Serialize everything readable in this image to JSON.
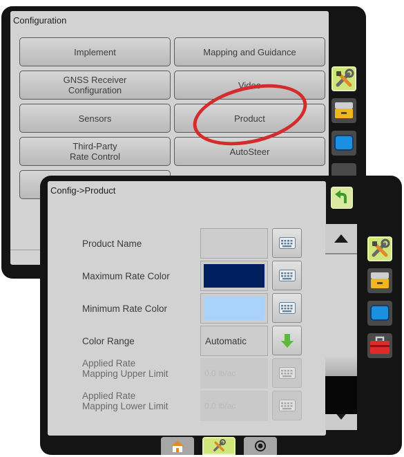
{
  "config_screen": {
    "title": "Configuration",
    "buttons": [
      {
        "label": "Implement"
      },
      {
        "label": "Mapping and Guidance"
      },
      {
        "label": "GNSS Receiver\nConfiguration"
      },
      {
        "label": "Video"
      },
      {
        "label": "Sensors"
      },
      {
        "label": "Product"
      },
      {
        "label": "Third-Party\nRate Control"
      },
      {
        "label": "AutoSteer"
      }
    ]
  },
  "product_screen": {
    "title": "Config->Product",
    "rows": {
      "product_name": {
        "label": "Product Name",
        "value": ""
      },
      "max_rate_color": {
        "label": "Maximum Rate Color",
        "color": "#001f5e"
      },
      "min_rate_color": {
        "label": "Minimum Rate Color",
        "color": "#a9d3fb"
      },
      "color_range": {
        "label": "Color Range",
        "value": "Automatic"
      },
      "upper_limit": {
        "label": "Applied Rate\nMapping Upper Limit",
        "value": "0.0 lb/ac"
      },
      "lower_limit": {
        "label": "Applied Rate\nMapping Lower Limit",
        "value": "0.0 lb/ac"
      }
    }
  },
  "colors": {
    "accent_green": "#cfe77a",
    "highlight_red": "#d42c2c",
    "panel_bg": "#d2d2d2"
  },
  "icons": [
    "tools-icon",
    "storage-icon",
    "display-icon",
    "toolbox-icon",
    "back-arrow-icon",
    "keyboard-icon",
    "down-arrow-icon",
    "home-icon",
    "eye-icon"
  ]
}
